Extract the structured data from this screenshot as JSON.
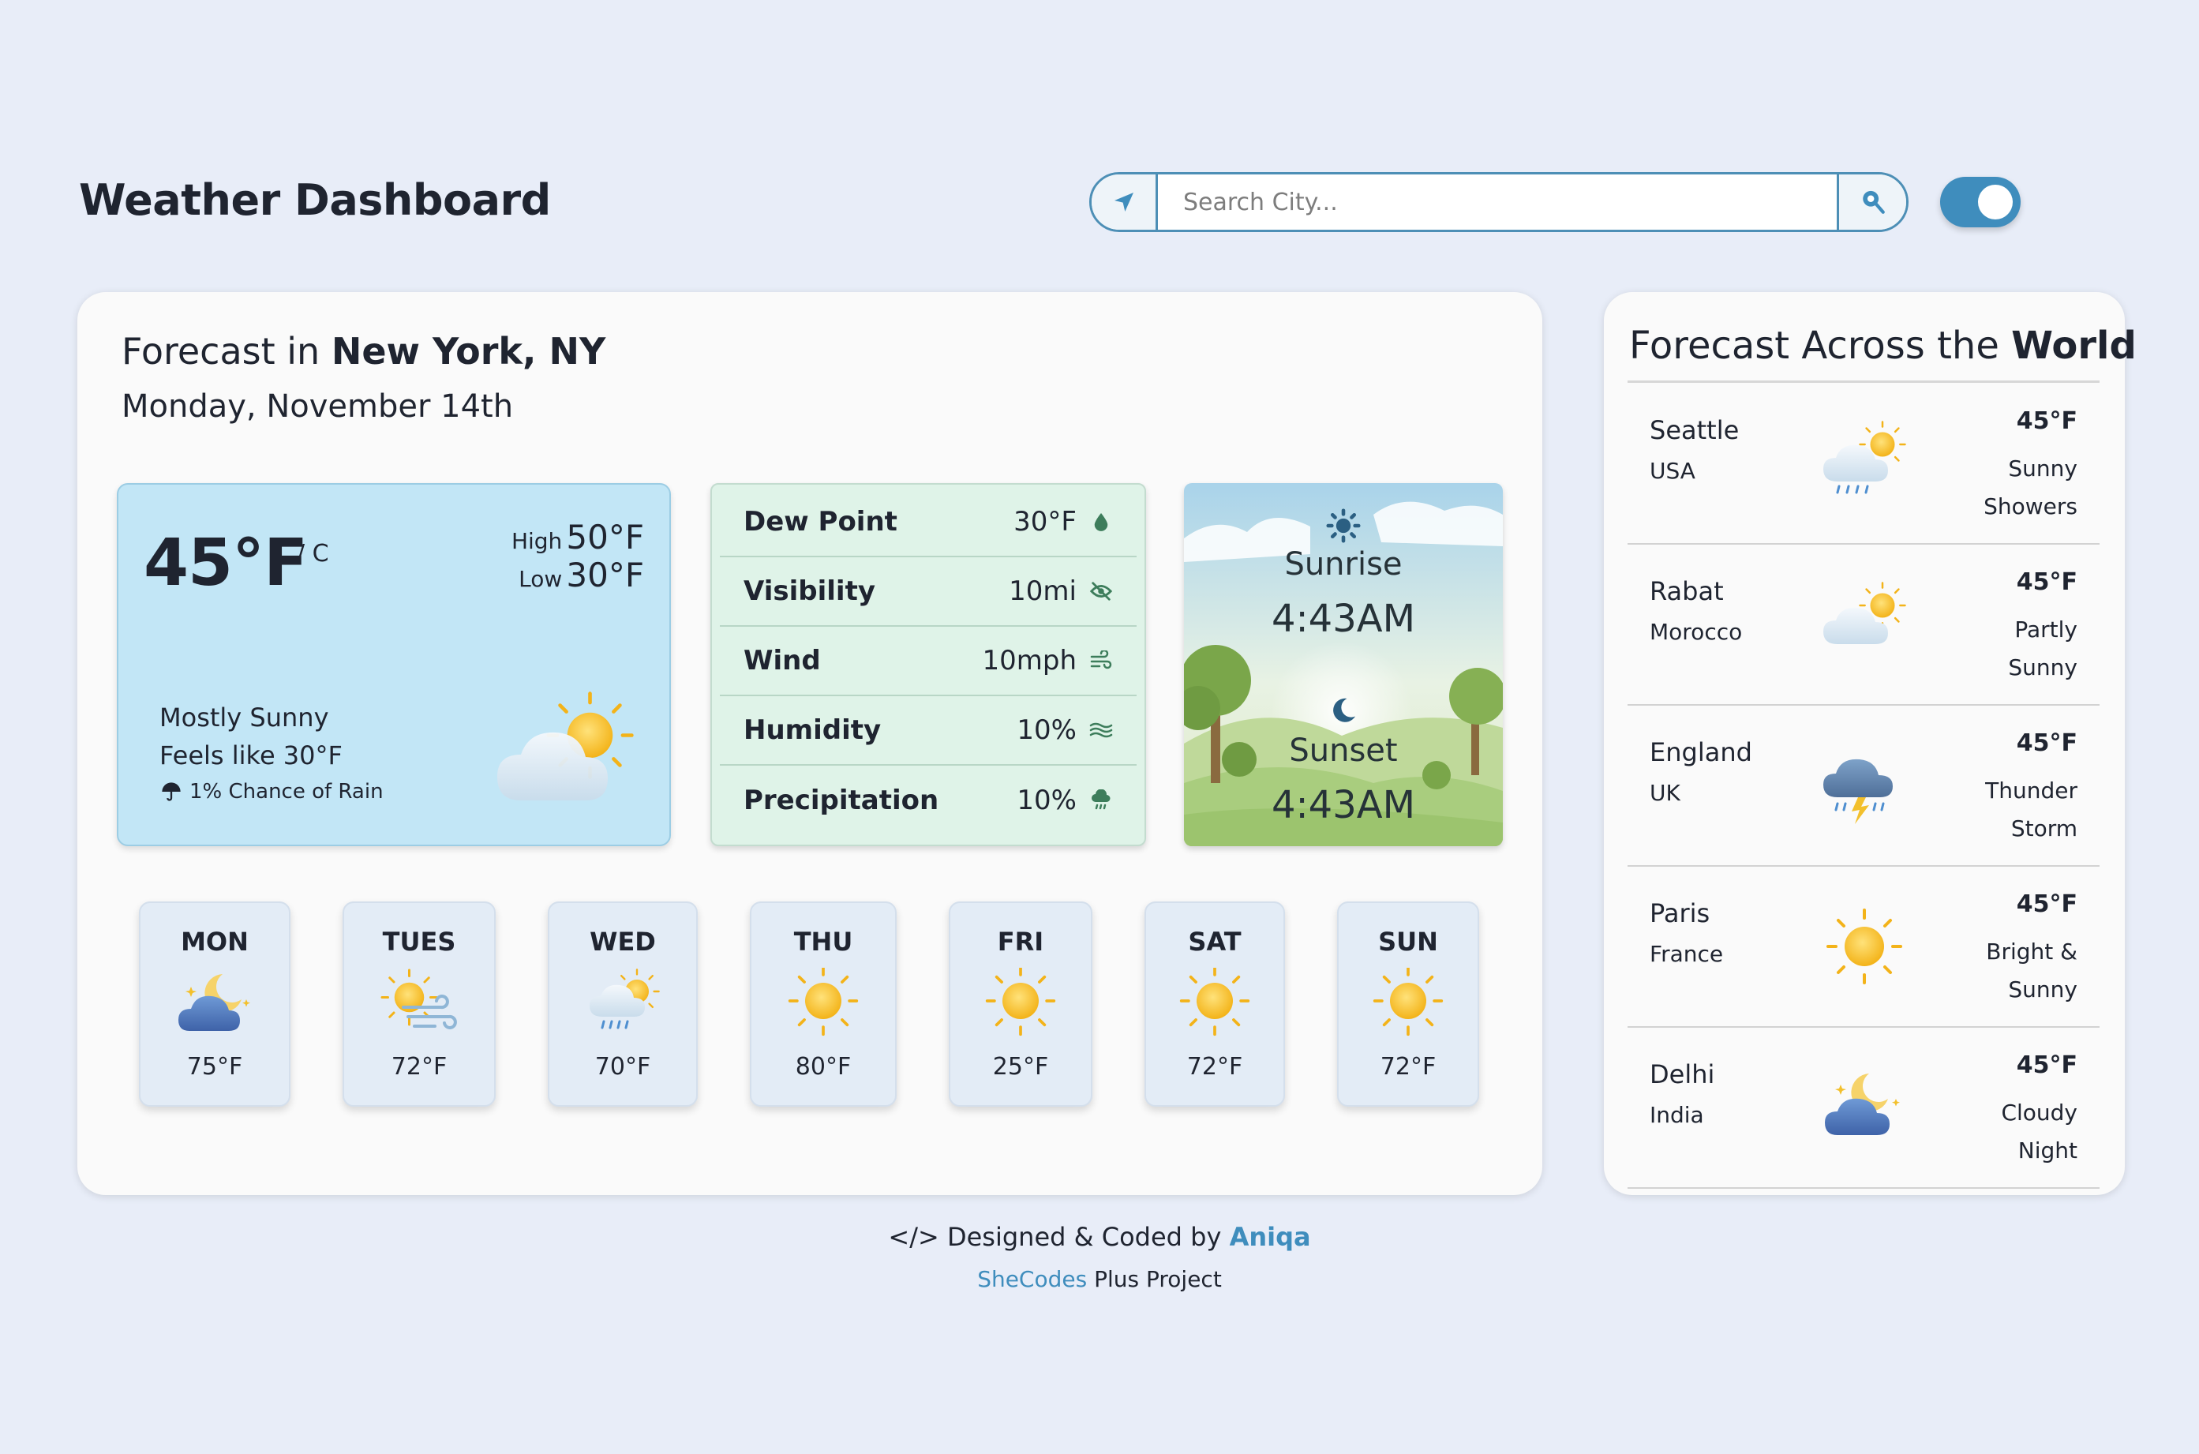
{
  "header": {
    "title": "Weather Dashboard",
    "search_placeholder": "Search City...",
    "location_icon": "location-arrow-icon",
    "search_icon": "search-pin-icon"
  },
  "forecast": {
    "heading_prefix": "Forecast in",
    "city": "New York, NY",
    "date": "Monday, November 14th",
    "current": {
      "temp": "45°F",
      "unit_toggle": "/ C",
      "high_label": "High",
      "high": "50°F",
      "low_label": "Low",
      "low": "30°F",
      "condition": "Mostly Sunny",
      "feels_like": "Feels like 30°F",
      "rain": "1% Chance of Rain"
    },
    "details": [
      {
        "label": "Dew Point",
        "value": "30°F",
        "icon": "droplet-icon"
      },
      {
        "label": "Visibility",
        "value": "10mi",
        "icon": "eye-slash-icon"
      },
      {
        "label": "Wind",
        "value": "10mph",
        "icon": "wind-icon"
      },
      {
        "label": "Humidity",
        "value": "10%",
        "icon": "humidity-icon"
      },
      {
        "label": "Precipitation",
        "value": "10%",
        "icon": "cloud-rain-icon"
      }
    ],
    "sun": {
      "sunrise_label": "Sunrise",
      "sunrise_time": "4:43AM",
      "sunset_label": "Sunset",
      "sunset_time": "4:43AM"
    },
    "week": [
      {
        "day": "MON",
        "temp": "75°F",
        "icon": "cloudy-night-icon"
      },
      {
        "day": "TUES",
        "temp": "72°F",
        "icon": "sun-wind-icon"
      },
      {
        "day": "WED",
        "temp": "70°F",
        "icon": "sun-rain-icon"
      },
      {
        "day": "THU",
        "temp": "80°F",
        "icon": "sun-icon"
      },
      {
        "day": "FRI",
        "temp": "25°F",
        "icon": "sun-icon"
      },
      {
        "day": "SAT",
        "temp": "72°F",
        "icon": "sun-icon"
      },
      {
        "day": "SUN",
        "temp": "72°F",
        "icon": "sun-icon"
      }
    ]
  },
  "world": {
    "heading_prefix": "Forecast Across the",
    "heading_bold": "World",
    "cities": [
      {
        "name": "Seattle",
        "country": "USA",
        "temp": "45°F",
        "desc1": "Sunny",
        "desc2": "Showers",
        "icon": "sun-rain-icon"
      },
      {
        "name": "Rabat",
        "country": "Morocco",
        "temp": "45°F",
        "desc1": "Partly",
        "desc2": "Sunny",
        "icon": "partly-sunny-icon"
      },
      {
        "name": "England",
        "country": "UK",
        "temp": "45°F",
        "desc1": "Thunder",
        "desc2": "Storm",
        "icon": "thunderstorm-icon"
      },
      {
        "name": "Paris",
        "country": "France",
        "temp": "45°F",
        "desc1": "Bright &",
        "desc2": "Sunny",
        "icon": "sun-icon"
      },
      {
        "name": "Delhi",
        "country": "India",
        "temp": "45°F",
        "desc1": "Cloudy",
        "desc2": "Night",
        "icon": "cloudy-night-icon"
      }
    ]
  },
  "footer": {
    "code_symbol": "</>",
    "designed_text": "Designed & Coded by",
    "author": "Aniqa",
    "org": "SheCodes",
    "project_text": "Plus Project"
  },
  "colors": {
    "background": "#e8edf8",
    "accent": "#3f8dbd",
    "current_card": "#c2e6f6",
    "details_card": "#dff3e8"
  }
}
